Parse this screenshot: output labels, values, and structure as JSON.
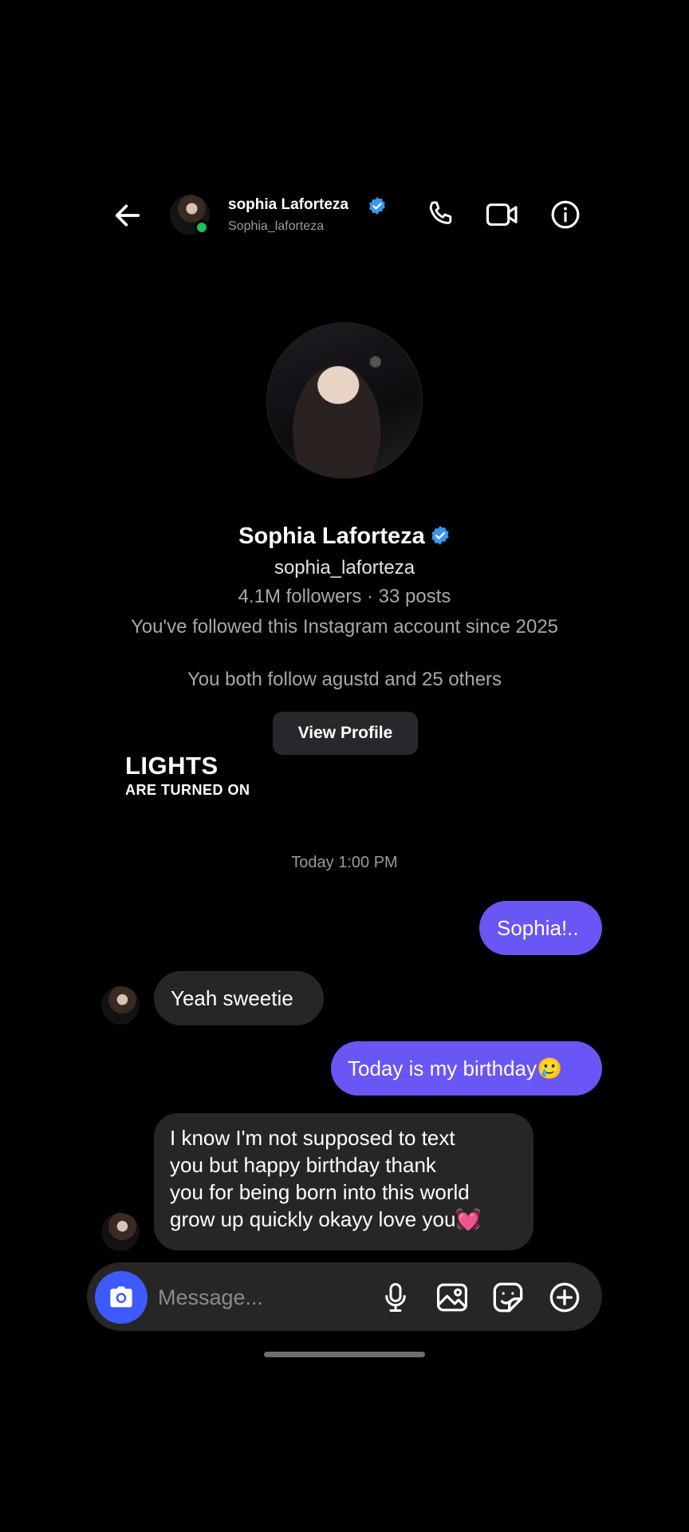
{
  "header": {
    "name": "sophia Laforteza",
    "username": "Sophia_laforteza"
  },
  "profile": {
    "name": "Sophia Laforteza",
    "username": "sophia_laforteza",
    "stats": "4.1M followers · 33 posts",
    "followed_since": "You've followed this Instagram account since 2025",
    "mutual": "You both follow agustd and 25 others",
    "view_profile_label": "View Profile"
  },
  "overlay": {
    "title": "LIGHTS",
    "subtitle": "ARE TURNED ON"
  },
  "chat": {
    "timestamp": "Today 1:00 PM",
    "messages": [
      {
        "from": "me",
        "text": "Sophia!.."
      },
      {
        "from": "them",
        "text": "Yeah sweetie"
      },
      {
        "from": "me",
        "text": "Today is my birthday🥲"
      },
      {
        "from": "them",
        "lines": [
          "I know I'm not supposed to text",
          "you but happy birthday thank",
          "you for being born into this world",
          "grow up quickly okayy love you💓"
        ]
      }
    ]
  },
  "composer": {
    "placeholder": "Message..."
  },
  "colors": {
    "outgoing_bubble": "#6a55f5",
    "incoming_bubble": "#262626",
    "verified": "#3897f0",
    "camera_button": "#3d5afe",
    "online": "#1fbf5a"
  },
  "icons": [
    "back-arrow-icon",
    "verified-badge-icon",
    "phone-icon",
    "video-camera-icon",
    "info-icon",
    "camera-icon",
    "microphone-icon",
    "gallery-icon",
    "sticker-icon",
    "plus-circle-icon"
  ]
}
